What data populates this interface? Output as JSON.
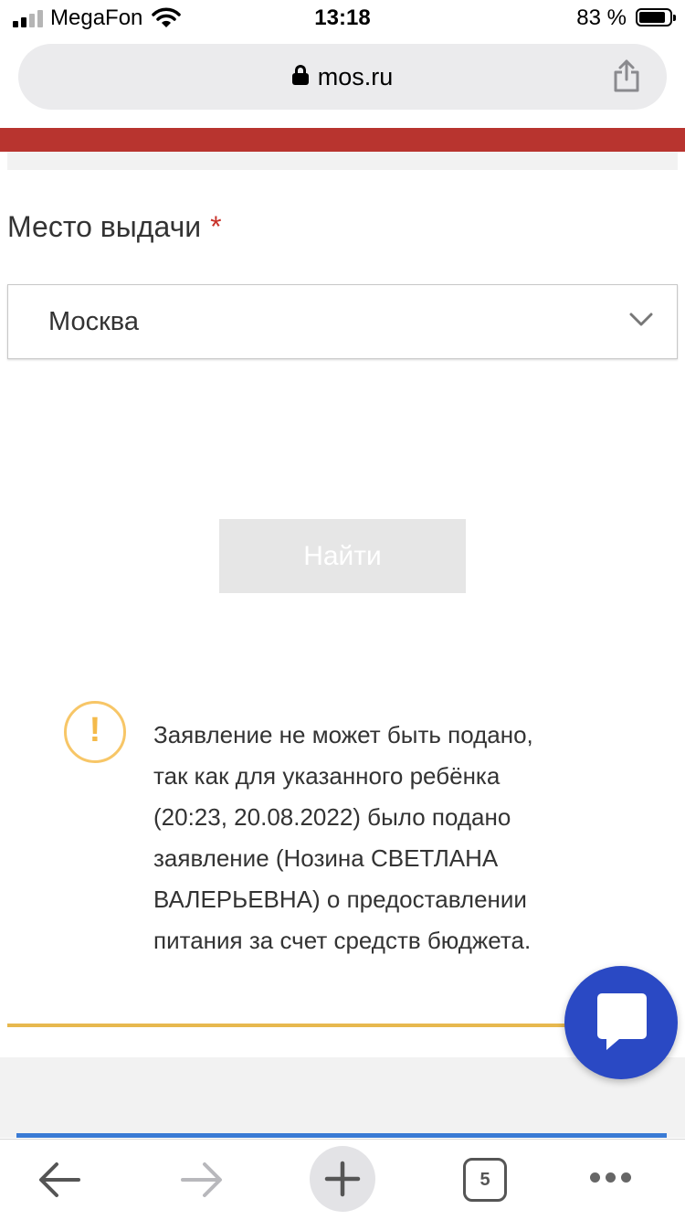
{
  "status_bar": {
    "carrier": "MegaFon",
    "time": "13:18",
    "battery": "83 %"
  },
  "browser": {
    "url": "mos.ru",
    "open_tabs": "5"
  },
  "form": {
    "place_label": "Место выдачи",
    "required_mark": "*",
    "place_value": "Москва",
    "search_button": "Найти"
  },
  "warning": {
    "icon_glyph": "!",
    "lines": [
      "Заявление не может быть подано,",
      "так как для указанного ребёнка",
      "(20:23, 20.08.2022) было подано",
      "заявление (Нозина СВЕТЛАНА",
      "ВАЛЕРЬЕВНА) о предоставлении",
      "питания за счет средств бюджета."
    ]
  },
  "colors": {
    "header_red": "#b8342f",
    "required_red": "#c8322a",
    "warning_yellow": "#f4ba4a",
    "divider_gold": "#e7b84e",
    "chat_blue": "#2a49c4"
  },
  "icons": [
    "signal-icon",
    "wifi-icon",
    "battery-icon",
    "lock-icon",
    "share-icon",
    "chevron-down-icon",
    "warning-icon",
    "chat-icon",
    "back-arrow-icon",
    "forward-arrow-icon",
    "plus-icon",
    "more-icon"
  ]
}
